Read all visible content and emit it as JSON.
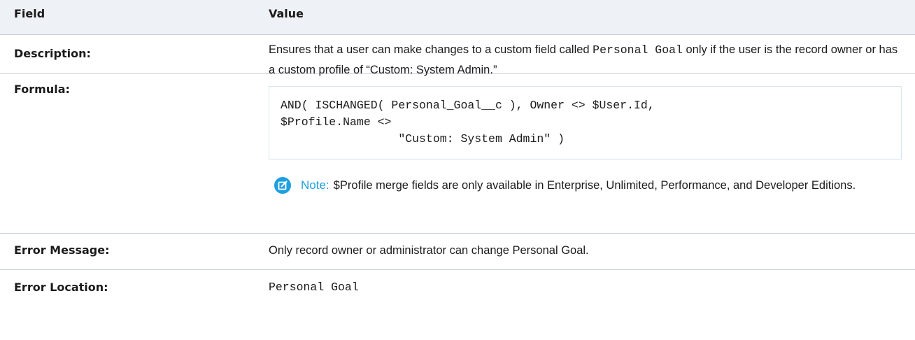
{
  "header": {
    "field": "Field",
    "value": "Value"
  },
  "description": {
    "label": "Description:",
    "text_before": "Ensures that a user can make changes to a custom field called ",
    "code": "Personal Goal",
    "text_after": " only if the user is the record owner or has a custom profile of “Custom: System Admin.”"
  },
  "formula": {
    "label": "Formula:",
    "code": "AND( ISCHANGED( Personal_Goal__c ), Owner <> $User.Id,\n$Profile.Name <>\n                 \"Custom: System Admin\" )",
    "note_label": "Note:",
    "note_text": "$Profile merge fields are only available in Enterprise, Unlimited, Performance, and Developer Editions.",
    "note_icon": "edit-note-icon",
    "note_color": "#1e9fe0"
  },
  "error_message": {
    "label": "Error Message:",
    "text": "Only record owner or administrator can change Personal Goal."
  },
  "error_location": {
    "label": "Error Location:",
    "text": "Personal Goal"
  }
}
